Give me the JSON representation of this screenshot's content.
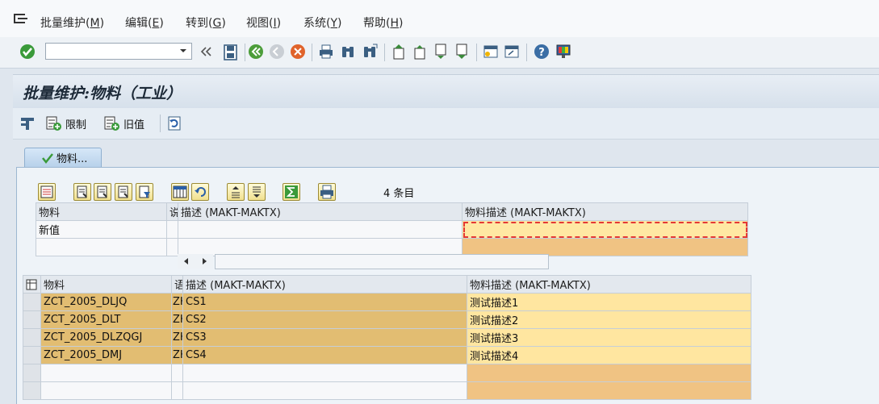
{
  "menu": {
    "items": [
      {
        "label": "批量维护(",
        "key": "M",
        "suffix": ")"
      },
      {
        "label": "编辑(",
        "key": "E",
        "suffix": ")"
      },
      {
        "label": "转到(",
        "key": "G",
        "suffix": ")"
      },
      {
        "label": "视图(",
        "key": "I",
        "suffix": ")"
      },
      {
        "label": "系统(",
        "key": "Y",
        "suffix": ")"
      },
      {
        "label": "帮助(",
        "key": "H",
        "suffix": ")"
      }
    ]
  },
  "toolbar": {
    "command_field_value": "",
    "icons": [
      "check-icon",
      "back-icon",
      "save-icon",
      "green-back-icon",
      "exit-icon",
      "cancel-icon",
      "print-icon",
      "find-icon",
      "find-next-icon",
      "first-page-icon",
      "prev-page-icon",
      "next-page-icon",
      "last-page-icon",
      "create-session-icon",
      "shortcut-icon",
      "help-icon",
      "layout-icon"
    ]
  },
  "page": {
    "title": "批量维护:物料（工业）"
  },
  "app_toolbar": {
    "restrict_label": "限制",
    "old_value_label": "旧值"
  },
  "tab": {
    "label": "物料..."
  },
  "grid": {
    "row_count": "4 条目"
  },
  "new_values_table": {
    "columns": [
      "物料",
      "说",
      "描述 (MAKT-MAKTX)",
      "物料描述 (MAKT-MAKTX)"
    ],
    "row_label": "新值"
  },
  "data_table": {
    "columns": [
      "物料",
      "语",
      "描述 (MAKT-MAKTX)",
      "物料描述 (MAKT-MAKTX)"
    ],
    "rows": [
      {
        "material": "ZCT_2005_DLJQ",
        "lang": "ZH",
        "desc": "CS1",
        "new_desc": "测试描述1"
      },
      {
        "material": "ZCT_2005_DLT",
        "lang": "ZH",
        "desc": "CS2",
        "new_desc": "测试描述2"
      },
      {
        "material": "ZCT_2005_DLZQGJ",
        "lang": "ZH",
        "desc": "CS3",
        "new_desc": "测试描述3"
      },
      {
        "material": "ZCT_2005_DMJ",
        "lang": "ZH",
        "desc": "CS4",
        "new_desc": "测试描述4"
      }
    ]
  },
  "colors": {
    "accent_highlight": "#e53935",
    "key_column": "#e2bd72",
    "editable_cell": "#ffe8a3"
  }
}
